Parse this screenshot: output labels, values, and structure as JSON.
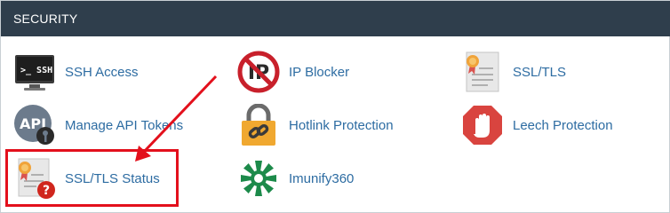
{
  "section": {
    "title": "SECURITY"
  },
  "items": [
    {
      "label": "SSH Access",
      "icon": "terminal-ssh-icon"
    },
    {
      "label": "IP Blocker",
      "icon": "ip-blocked-icon"
    },
    {
      "label": "SSL/TLS",
      "icon": "certificate-icon"
    },
    {
      "label": "Manage API Tokens",
      "icon": "api-key-icon"
    },
    {
      "label": "Hotlink Protection",
      "icon": "padlock-chain-icon"
    },
    {
      "label": "Leech Protection",
      "icon": "stop-hand-icon"
    },
    {
      "label": "SSL/TLS Status",
      "icon": "certificate-question-icon"
    },
    {
      "label": "Imunify360",
      "icon": "imunify-logo-icon"
    }
  ],
  "icon_text": {
    "ssh": ">_ SSH",
    "ip": "IP",
    "api": "API",
    "question": "?"
  },
  "annotation": {
    "highlight_color": "#e3101c",
    "highlighted_item": "SSL/TLS Status"
  }
}
